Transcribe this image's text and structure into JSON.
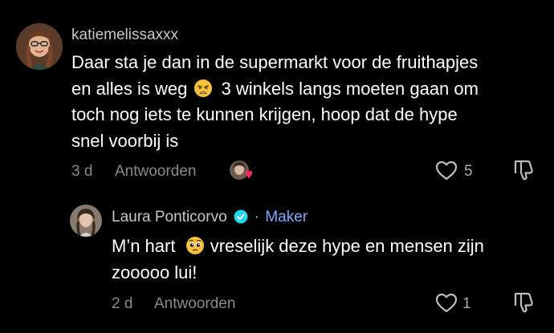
{
  "comments": [
    {
      "username": "katiemelissaxxx",
      "text_line1": "Daar sta je dan in de supermarkt voor de fruithapjes",
      "text_line2a": "en alles is weg",
      "emoji_icon": "weary-face-emoji",
      "text_line2b": "3 winkels langs moeten gaan om",
      "text_line3": "toch nog iets te kunnen krijgen, hoop dat de hype",
      "text_line4": "snel voorbij is",
      "time": "3 d",
      "reply_label": "Antwoorden",
      "likes": "5",
      "liked_by_creator_icon": "creator-avatar-heart-icon"
    },
    {
      "username": "Laura Ponticorvo",
      "verified_icon": "verified-badge-icon",
      "separator": "·",
      "role_label": "Maker",
      "text_line1a": "M’n hart",
      "emoji_icon": "pleading-face-emoji",
      "text_line1b": "vreselijk deze hype en mensen zijn",
      "text_line2": "zooooo lui!",
      "time": "2 d",
      "reply_label": "Antwoorden",
      "likes": "1"
    }
  ],
  "colors": {
    "background": "#000000",
    "username": "#c7c7c7",
    "meta": "#8a8a8a",
    "maker": "#7ea9ff",
    "verified": "#20d5ec",
    "heart": "#fe2c55"
  }
}
